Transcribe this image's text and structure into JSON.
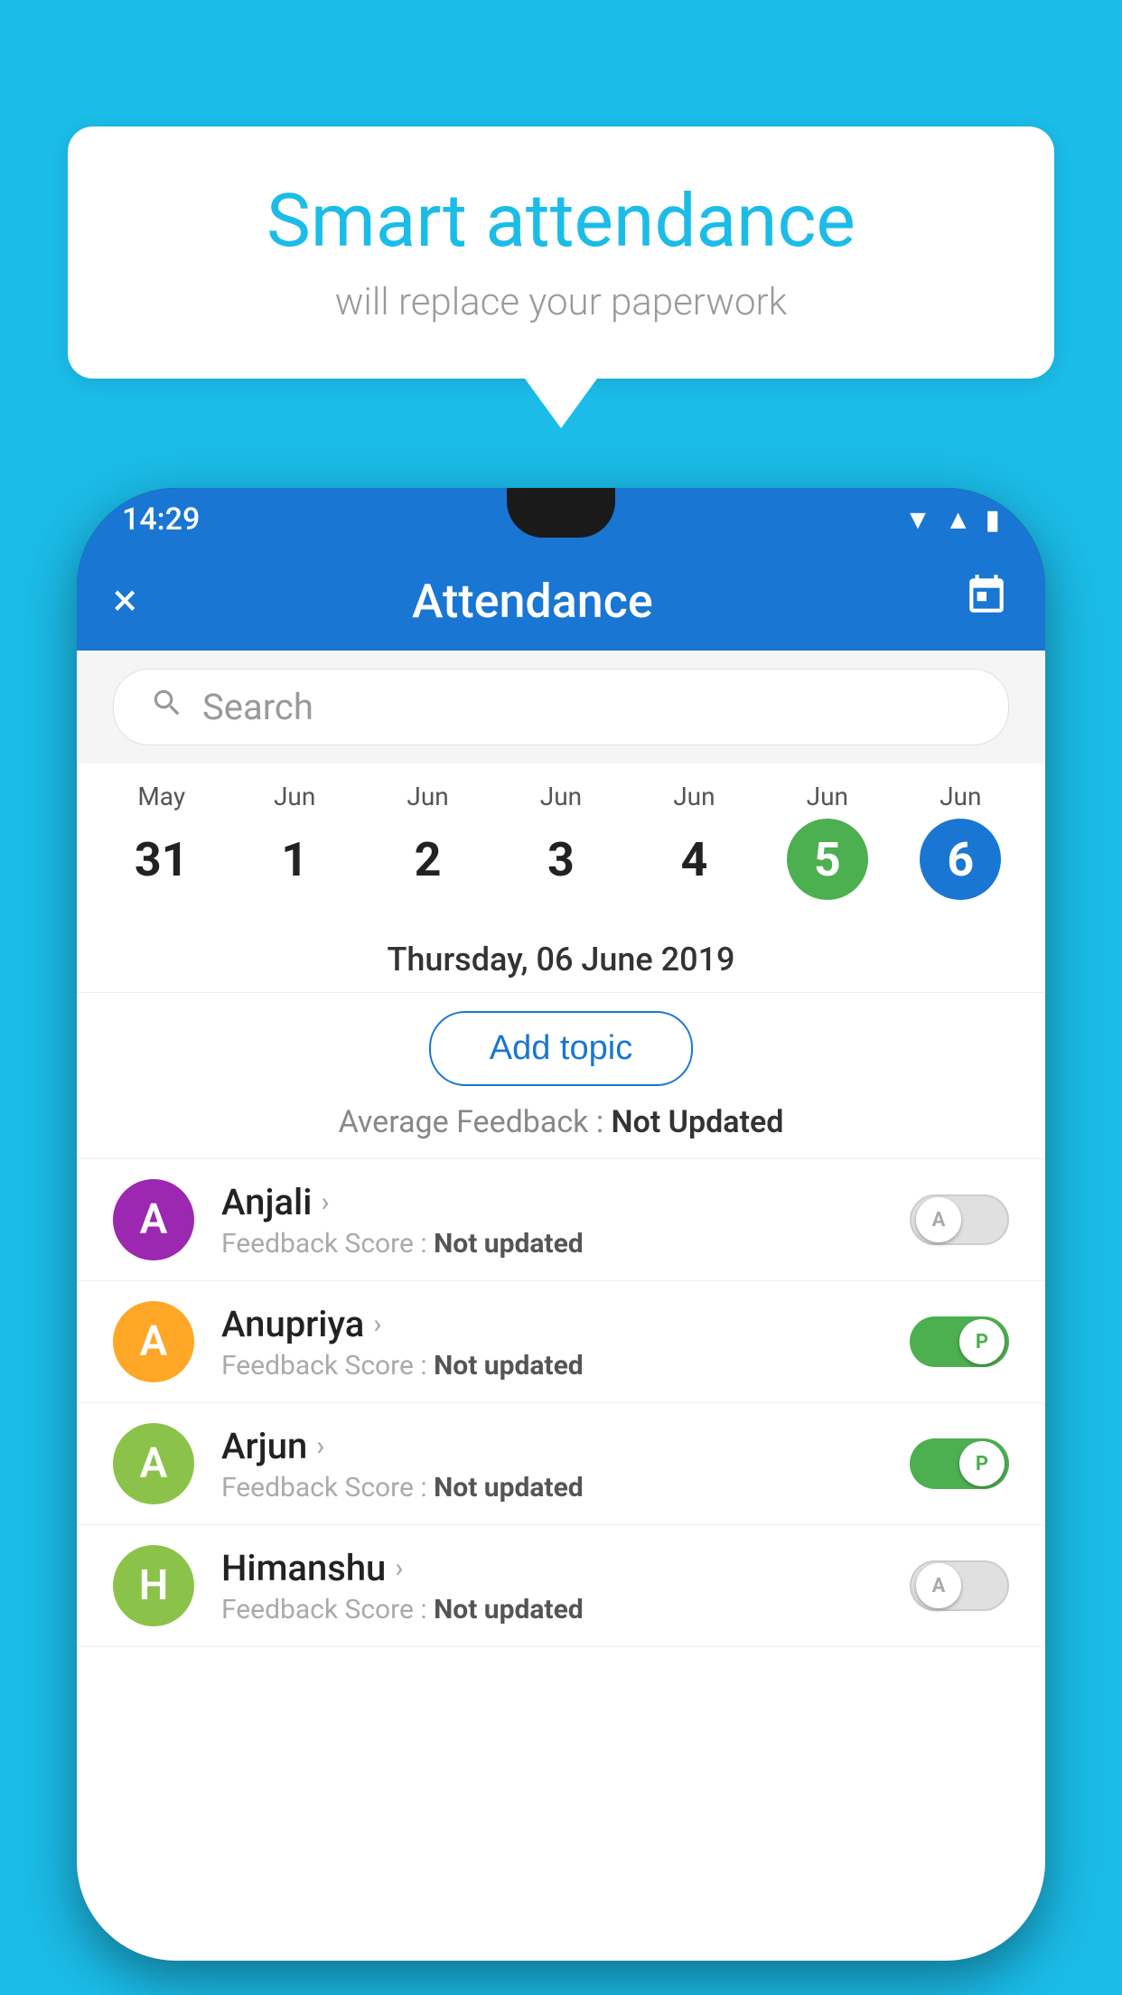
{
  "background": {
    "color": "#1BBCE8"
  },
  "speech_bubble": {
    "title": "Smart attendance",
    "subtitle": "will replace your paperwork"
  },
  "status_bar": {
    "time": "14:29",
    "icons": [
      "wifi",
      "signal",
      "battery"
    ]
  },
  "app_bar": {
    "title": "Attendance",
    "close_label": "×",
    "calendar_icon": "📅"
  },
  "search": {
    "placeholder": "Search"
  },
  "calendar": {
    "days": [
      {
        "month": "May",
        "date": "31"
      },
      {
        "month": "Jun",
        "date": "1"
      },
      {
        "month": "Jun",
        "date": "2"
      },
      {
        "month": "Jun",
        "date": "3"
      },
      {
        "month": "Jun",
        "date": "4"
      },
      {
        "month": "Jun",
        "date": "5",
        "state": "today"
      },
      {
        "month": "Jun",
        "date": "6",
        "state": "selected"
      }
    ]
  },
  "selected_date": "Thursday, 06 June 2019",
  "add_topic_label": "Add topic",
  "average_feedback": {
    "label": "Average Feedback : ",
    "value": "Not Updated"
  },
  "students": [
    {
      "name": "Anjali",
      "avatar_letter": "A",
      "avatar_color": "#9C27B0",
      "feedback_label": "Feedback Score : ",
      "feedback_value": "Not updated",
      "toggle": "off",
      "toggle_letter": "A"
    },
    {
      "name": "Anupriya",
      "avatar_letter": "A",
      "avatar_color": "#FFA726",
      "feedback_label": "Feedback Score : ",
      "feedback_value": "Not updated",
      "toggle": "on",
      "toggle_letter": "P"
    },
    {
      "name": "Arjun",
      "avatar_letter": "A",
      "avatar_color": "#8BC34A",
      "feedback_label": "Feedback Score : ",
      "feedback_value": "Not updated",
      "toggle": "on",
      "toggle_letter": "P"
    },
    {
      "name": "Himanshu",
      "avatar_letter": "H",
      "avatar_color": "#8BC34A",
      "feedback_label": "Feedback Score : ",
      "feedback_value": "Not updated",
      "toggle": "off",
      "toggle_letter": "A"
    }
  ]
}
